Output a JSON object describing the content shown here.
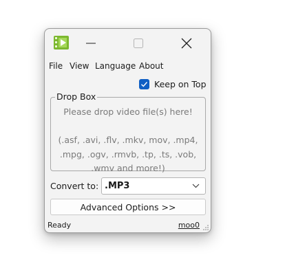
{
  "window": {
    "icon": "app-film-icon",
    "controls": {
      "minimize_icon": "minimize-icon",
      "maximize_icon": "maximize-icon",
      "close_icon": "close-icon"
    }
  },
  "menu": {
    "items": [
      {
        "label": "File"
      },
      {
        "label": "View"
      },
      {
        "label": "Language"
      },
      {
        "label": "About"
      }
    ]
  },
  "options": {
    "keep_on_top_label": "Keep on Top",
    "keep_on_top_checked": true
  },
  "dropbox": {
    "title": "Drop Box",
    "lines": [
      "Please drop video file(s) here!",
      "",
      "(.asf, .avi, .flv, .mkv, mov, .mp4,",
      ".mpg, .ogv, .rmvb, .tp, .ts, .vob,",
      ".wmv and more!)"
    ]
  },
  "convert": {
    "label": "Convert to:",
    "selected": ".MP3"
  },
  "advanced_button": "Advanced Options >>",
  "status": {
    "text": "Ready",
    "link": "moo0"
  },
  "colors": {
    "accent": "#0f5fc4",
    "window_bg": "#f3f3f3",
    "hint_text": "#7a7a7a"
  }
}
